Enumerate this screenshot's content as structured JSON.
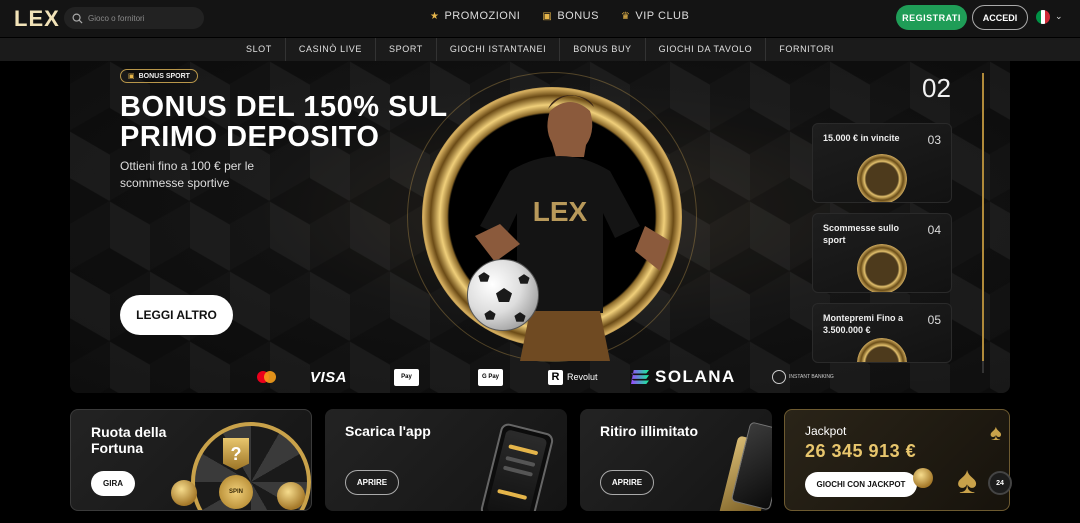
{
  "header": {
    "logo": "LEX",
    "search_placeholder": "Gioco o fornitori",
    "nav": [
      {
        "label": "PROMOZIONI",
        "icon": "star-icon"
      },
      {
        "label": "BONUS",
        "icon": "gift-icon"
      },
      {
        "label": "VIP CLUB",
        "icon": "crown-icon"
      }
    ],
    "register_label": "REGISTRATI",
    "login_label": "ACCEDI",
    "language_flag": "flag-italy-icon"
  },
  "categories": [
    "SLOT",
    "CASINÒ LIVE",
    "SPORT",
    "GIOCHI ISTANTANEI",
    "BONUS BUY",
    "GIOCHI DA TAVOLO",
    "FORNITORI"
  ],
  "hero": {
    "badge": "BONUS SPORT",
    "title": "BONUS DEL 150% SUL PRIMO DEPOSITO",
    "subtitle": "Ottieni fino a 100 € per le scommesse sportive",
    "cta": "LEGGI ALTRO",
    "shirt_text": "LEX",
    "current_slide": "02",
    "slides": [
      {
        "label": "15.000 € in vincite",
        "number": "03"
      },
      {
        "label": "Scommesse sullo sport",
        "number": "04"
      },
      {
        "label": "Montepremi Fino a 3.500.000 €",
        "number": "05"
      }
    ]
  },
  "payments": {
    "visa": "VISA",
    "apple_pay": "Pay",
    "google_pay": "G Pay",
    "revolut": "Revolut",
    "solana": "SOLANA",
    "instant_banking": "INSTANT BANKING"
  },
  "cards": {
    "wheel": {
      "title": "Ruota della Fortuna",
      "button": "GIRA",
      "spin_label": "SPIN",
      "mark": "?"
    },
    "app": {
      "title": "Scarica l'app",
      "button": "APRIRE"
    },
    "withdraw": {
      "title": "Ritiro illimitato",
      "button": "APRIRE"
    },
    "jackpot": {
      "title": "Jackpot",
      "amount": "26 345 913 €",
      "button": "GIOCHI CON JACKPOT"
    }
  },
  "support_badge": "24",
  "colors": {
    "accent_gold": "#e5b54a",
    "register_green": "#1f9d57",
    "background": "#000000"
  }
}
